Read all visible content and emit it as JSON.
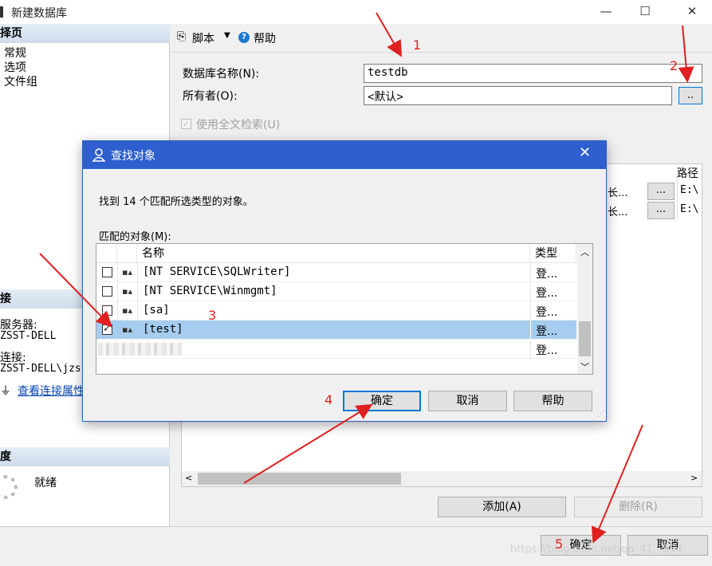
{
  "window": {
    "title": "新建数据库",
    "controls": [
      "—",
      "☐",
      "✕"
    ]
  },
  "left_pane": {
    "select_page_title": "择页",
    "pages": [
      "常规",
      "选项",
      "文件组"
    ],
    "connection_title": "接",
    "server_label": "服务器:",
    "server_value": "ZSST-DELL",
    "connection_label": "连接:",
    "connection_value": "ZSST-DELL\\jzs",
    "view_conn_props": "查看连接属性",
    "progress_title": "度",
    "progress_status": "就绪"
  },
  "toolbar": {
    "script_label": "脚本",
    "help_label": "帮助"
  },
  "form": {
    "db_name_label": "数据库名称(N):",
    "db_name_value": "testdb",
    "owner_label": "所有者(O):",
    "owner_value": "<默认>",
    "browse_label": "..",
    "fulltext_label": "使用全文检索(U)"
  },
  "files_grid": {
    "path_header": "路径",
    "rows": [
      {
        "trail": "长...",
        "btn": "...",
        "path": "E:\\"
      },
      {
        "trail": "长...",
        "btn": "...",
        "path": "E:\\"
      }
    ]
  },
  "main_buttons": {
    "add": "添加(A)",
    "remove": "删除(R)",
    "ok": "确定",
    "cancel": "取消"
  },
  "dialog": {
    "title": "查找对象",
    "found_text": "找到 14 个匹配所选类型的对象。",
    "matched_label": "匹配的对象(M):",
    "col_name": "名称",
    "col_type": "类型",
    "rows": [
      {
        "name": "[NT SERVICE\\SQLWriter]",
        "type": "登...",
        "checked": false
      },
      {
        "name": "[NT SERVICE\\Winmgmt]",
        "type": "登...",
        "checked": false
      },
      {
        "name": "[sa]",
        "type": "登...",
        "checked": false
      },
      {
        "name": "[test]",
        "type": "登...",
        "checked": true
      },
      {
        "name": "",
        "type": "登...",
        "checked": false
      }
    ],
    "ok": "确定",
    "cancel": "取消",
    "help": "帮助"
  },
  "annotations": {
    "n1": "1",
    "n2": "2",
    "n3": "3",
    "n4": "4",
    "n5": "5",
    "color": "#e02020"
  },
  "watermark": "https://blog.csdn.net/qq_41...854"
}
